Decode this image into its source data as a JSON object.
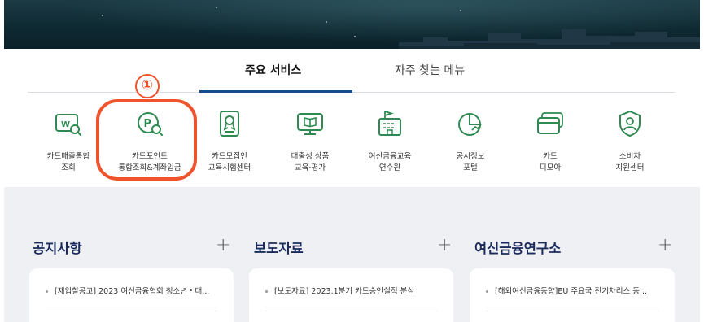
{
  "tabs": {
    "main_label": "주요 서비스",
    "sub_label": "자주 찾는 메뉴"
  },
  "step_badge": "①",
  "services": [
    {
      "icon": "card-sales-search-icon",
      "line1": "카드매출통합",
      "line2": "조회"
    },
    {
      "icon": "point-search-icon",
      "line1": "카드포인트",
      "line2": "통합조회&계좌입금"
    },
    {
      "icon": "recruiter-certificate-icon",
      "line1": "카드모집인",
      "line2": "교육시험센터"
    },
    {
      "icon": "monitor-book-icon",
      "line1": "대출성 상품",
      "line2": "교육·평가"
    },
    {
      "icon": "academy-building-icon",
      "line1": "여신금융교육",
      "line2": "연수원"
    },
    {
      "icon": "pie-chart-icon",
      "line1": "공시정보",
      "line2": "포털"
    },
    {
      "icon": "card-stack-icon",
      "line1": "카드",
      "line2": "디모아"
    },
    {
      "icon": "consumer-shield-icon",
      "line1": "소비자",
      "line2": "지원센터"
    }
  ],
  "sections": [
    {
      "title": "공지사항",
      "plus": "+",
      "item": "[재입찰공고] 2023 여신금융협회 청소년・대..."
    },
    {
      "title": "보도자료",
      "plus": "+",
      "item": "[보도자료] 2023.1분기 카드승인실적 분석"
    },
    {
      "title": "여신금융연구소",
      "plus": "+",
      "item": "[해외여신금융동향]EU 주요국 전기차리스 동..."
    }
  ],
  "colors": {
    "accent_navy": "#1a4a8e",
    "highlight_orange": "#f0532b",
    "icon_green": "#2f8a52",
    "section_title": "#1b2a5c",
    "gray_bg": "#eef0f4"
  }
}
